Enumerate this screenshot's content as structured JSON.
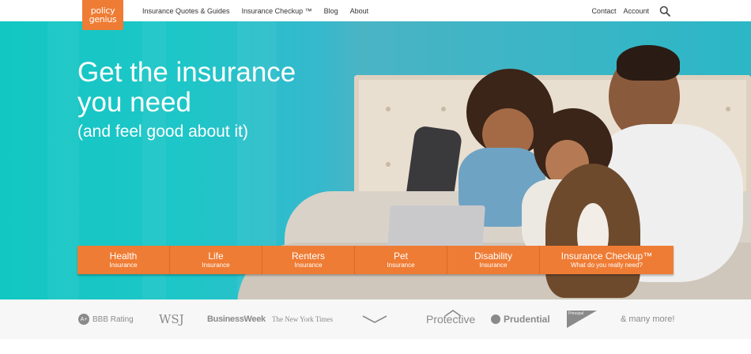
{
  "brand": {
    "logo_line1": "policy",
    "logo_line2": "genius",
    "accent": "#ef7c34",
    "hero_bg": "#1ec6c8"
  },
  "nav": {
    "left": [
      "Insurance Quotes & Guides",
      "Insurance Checkup ™",
      "Blog",
      "About"
    ],
    "right": [
      "Contact",
      "Account"
    ],
    "search_icon": "search-icon"
  },
  "hero": {
    "headline_line1": "Get the insurance",
    "headline_line2": "you need",
    "subheadline": "(and feel good about it)"
  },
  "categories": [
    {
      "title": "Health",
      "subtitle": "Insurance"
    },
    {
      "title": "Life",
      "subtitle": "Insurance"
    },
    {
      "title": "Renters",
      "subtitle": "Insurance"
    },
    {
      "title": "Pet",
      "subtitle": "Insurance"
    },
    {
      "title": "Disability",
      "subtitle": "Insurance"
    },
    {
      "title": "Insurance Checkup™",
      "subtitle": "What do you really need?"
    }
  ],
  "partners": {
    "bbb_badge": "A+",
    "bbb": "BBB Rating",
    "wsj": "WSJ",
    "businessweek": "BusinessWeek",
    "nyt": "The New York Times",
    "protective": "Protective",
    "prudential": "Prudential",
    "principal": "Principal",
    "more": "& many more!"
  }
}
